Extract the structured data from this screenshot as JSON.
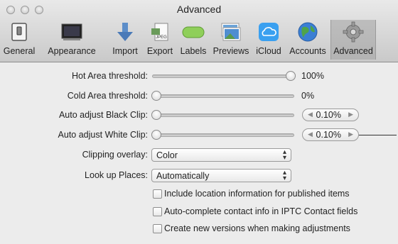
{
  "window": {
    "title": "Advanced"
  },
  "toolbar": {
    "items": [
      {
        "label": "General",
        "icon": "general-switch-icon"
      },
      {
        "label": "Appearance",
        "icon": "monitor-icon"
      },
      {
        "label": "Import",
        "icon": "download-arrow-icon"
      },
      {
        "label": "Export",
        "icon": "jpeg-file-icon"
      },
      {
        "label": "Labels",
        "icon": "label-pill-icon"
      },
      {
        "label": "Previews",
        "icon": "photo-stack-icon"
      },
      {
        "label": "iCloud",
        "icon": "cloud-icon"
      },
      {
        "label": "Accounts",
        "icon": "globe-icon"
      },
      {
        "label": "Advanced",
        "icon": "gear-icon",
        "selected": true
      }
    ]
  },
  "settings": {
    "hot_area": {
      "label": "Hot Area threshold:",
      "value": "100%",
      "level": 1.0
    },
    "cold_area": {
      "label": "Cold Area threshold:",
      "value": "0%",
      "level": 0.0
    },
    "black_clip": {
      "label": "Auto adjust Black Clip:",
      "value": "0.10%",
      "level": 0.0
    },
    "white_clip": {
      "label": "Auto adjust White Clip:",
      "value": "0.10%",
      "level": 0.0
    },
    "clipping_overlay": {
      "label": "Clipping overlay:",
      "value": "Color"
    },
    "look_up_places": {
      "label": "Look up Places:",
      "value": "Automatically"
    },
    "checkboxes": [
      {
        "label": "Include location information for published items",
        "checked": false
      },
      {
        "label": "Auto-complete contact info in IPTC Contact fields",
        "checked": false
      },
      {
        "label": "Create new versions when making adjustments",
        "checked": false
      }
    ]
  },
  "colors": {
    "selected_tab": "#b6b6b6",
    "window_bg": "#ececec",
    "icloud_blue": "#3aa0f0"
  }
}
